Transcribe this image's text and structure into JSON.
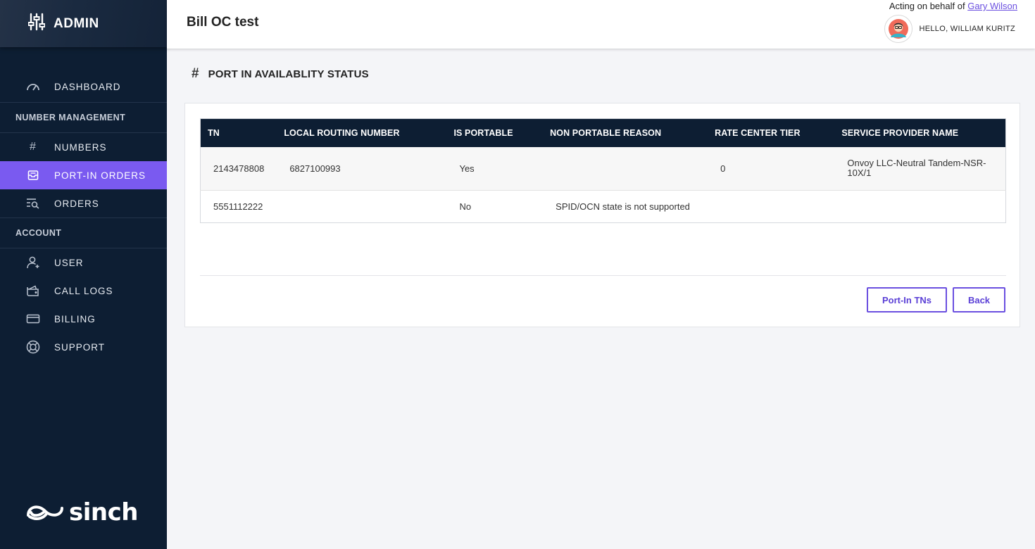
{
  "sidebar": {
    "brand": "ADMIN",
    "items": [
      {
        "type": "item",
        "label": "DASHBOARD",
        "icon": "gauge-icon"
      },
      {
        "type": "section",
        "label": "NUMBER MANAGEMENT"
      },
      {
        "type": "item",
        "label": "NUMBERS",
        "icon": "hash-icon"
      },
      {
        "type": "item",
        "label": "PORT-IN ORDERS",
        "icon": "inbox-icon",
        "active": true
      },
      {
        "type": "item",
        "label": "ORDERS",
        "icon": "list-search-icon"
      },
      {
        "type": "section",
        "label": "ACCOUNT"
      },
      {
        "type": "item",
        "label": "USER",
        "icon": "user-add-icon"
      },
      {
        "type": "item",
        "label": "CALL LOGS",
        "icon": "wallet-icon"
      },
      {
        "type": "item",
        "label": "BILLING",
        "icon": "credit-card-icon"
      },
      {
        "type": "item",
        "label": "SUPPORT",
        "icon": "lifebuoy-icon"
      }
    ],
    "logo_text": "sinch"
  },
  "header": {
    "title": "Bill OC test",
    "acting_prefix": "Acting on behalf of",
    "acting_user": "Gary Wilson",
    "hello": "HELLO, WILLIAM KURITZ"
  },
  "main": {
    "heading_symbol": "#",
    "heading": "PORT IN AVAILABLITY STATUS",
    "table": {
      "columns": [
        "TN",
        "LOCAL ROUTING NUMBER",
        "IS PORTABLE",
        "NON PORTABLE REASON",
        "RATE CENTER TIER",
        "SERVICE PROVIDER NAME"
      ],
      "rows": [
        [
          "2143478808",
          "6827100993",
          "Yes",
          "",
          "0",
          "Onvoy LLC-Neutral Tandem-NSR-10X/1"
        ],
        [
          "5551112222",
          "",
          "No",
          "SPID/OCN state is not supported",
          "",
          ""
        ]
      ]
    },
    "buttons": {
      "port_in": "Port-In TNs",
      "back": "Back"
    }
  },
  "colors": {
    "sidebar_bg": "#0d1e33",
    "accent": "#7a5af0",
    "table_header_bg": "#0d1e33",
    "link": "#6a4fe0"
  }
}
